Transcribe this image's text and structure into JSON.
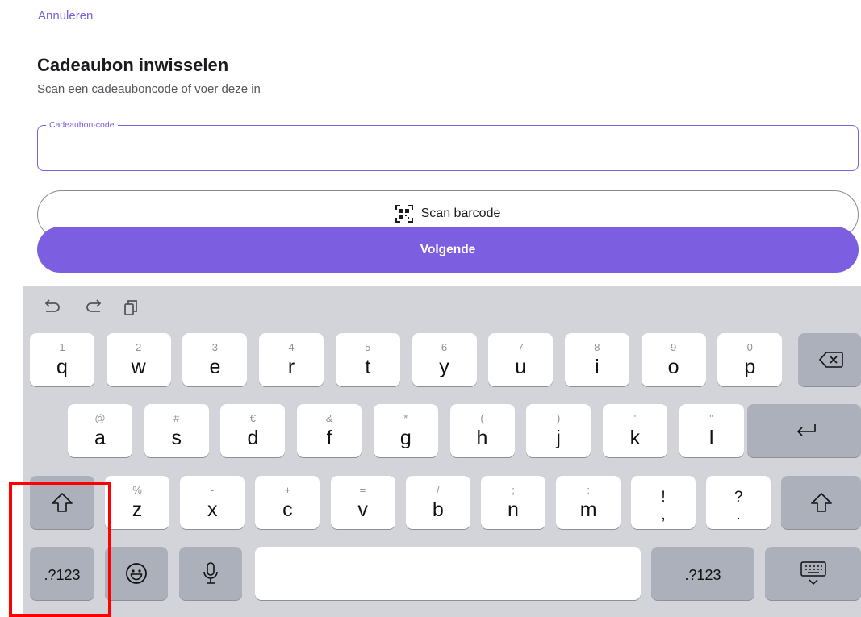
{
  "header": {
    "cancel_label": "Annuleren",
    "title": "Cadeaubon inwisselen",
    "subtitle": "Scan een cadeauboncode of voer deze in"
  },
  "code_field": {
    "label": "Cadeaubon-code",
    "value": ""
  },
  "scan_button": {
    "label": "Scan barcode",
    "icon": "barcode-scan-icon"
  },
  "next_button": {
    "label": "Volgende"
  },
  "colors": {
    "accent": "#7b5fe0",
    "field_border": "#7b62d9",
    "keyboard_bg": "#d2d4da",
    "key_dark": "#abb0ba",
    "highlight": "#ff0000"
  },
  "keyboard": {
    "assist_icons": [
      "undo-icon",
      "redo-icon",
      "clipboard-icon"
    ],
    "row1": [
      {
        "sec": "1",
        "pri": "q"
      },
      {
        "sec": "2",
        "pri": "w"
      },
      {
        "sec": "3",
        "pri": "e"
      },
      {
        "sec": "4",
        "pri": "r"
      },
      {
        "sec": "5",
        "pri": "t"
      },
      {
        "sec": "6",
        "pri": "y"
      },
      {
        "sec": "7",
        "pri": "u"
      },
      {
        "sec": "8",
        "pri": "i"
      },
      {
        "sec": "9",
        "pri": "o"
      },
      {
        "sec": "0",
        "pri": "p"
      }
    ],
    "row2": [
      {
        "sec": "@",
        "pri": "a"
      },
      {
        "sec": "#",
        "pri": "s"
      },
      {
        "sec": "€",
        "pri": "d"
      },
      {
        "sec": "&",
        "pri": "f"
      },
      {
        "sec": "*",
        "pri": "g"
      },
      {
        "sec": "(",
        "pri": "h"
      },
      {
        "sec": ")",
        "pri": "j"
      },
      {
        "sec": "'",
        "pri": "k"
      },
      {
        "sec": "\"",
        "pri": "l"
      }
    ],
    "row3": [
      {
        "sec": "%",
        "pri": "z"
      },
      {
        "sec": "-",
        "pri": "x"
      },
      {
        "sec": "+",
        "pri": "c"
      },
      {
        "sec": "=",
        "pri": "v"
      },
      {
        "sec": "/",
        "pri": "b"
      },
      {
        "sec": ";",
        "pri": "n"
      },
      {
        "sec": ":",
        "pri": "m"
      }
    ],
    "punct_keys": [
      {
        "top": "!",
        "bottom": ","
      },
      {
        "top": "?",
        "bottom": "."
      }
    ],
    "numbers_label_left": ".?123",
    "numbers_label_right": ".?123",
    "space_label": ""
  }
}
